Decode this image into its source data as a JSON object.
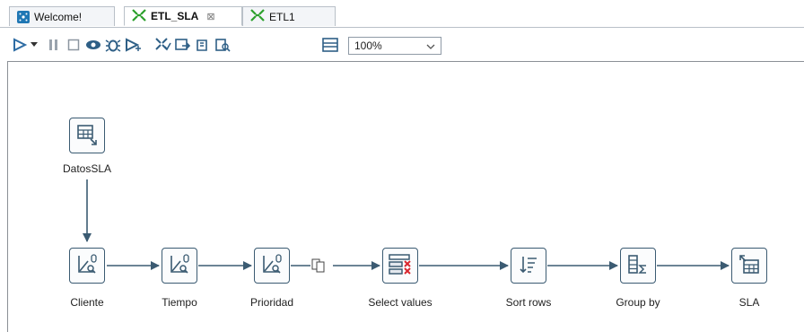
{
  "tabs": [
    {
      "label": "Welcome!",
      "active": false
    },
    {
      "label": "ETL_SLA",
      "close_glyph": "⊠",
      "active": true
    },
    {
      "label": "ETL1",
      "active": false
    }
  ],
  "toolbar": {
    "zoom_value": "100%",
    "icons": [
      "run-icon",
      "run-dropdown-icon",
      "pause-icon",
      "stop-icon",
      "preview-icon",
      "debug-icon",
      "replay-icon",
      "verify-icon",
      "impact-icon",
      "sql-icon",
      "explore-db-icon",
      "results-pane-icon"
    ]
  },
  "colors": {
    "accent": "#1f77b4",
    "hop": "#3b5b72",
    "step_border": "#3b5b72",
    "red_x": "#d9272e",
    "green_tab_icon": "#2ca02c"
  },
  "steps": {
    "datos_sla": "DatosSLA",
    "cliente": "Cliente",
    "tiempo": "Tiempo",
    "prioridad": "Prioridad",
    "select_values": "Select values",
    "sort_rows": "Sort rows",
    "group_by": "Group by",
    "sla": "SLA"
  }
}
